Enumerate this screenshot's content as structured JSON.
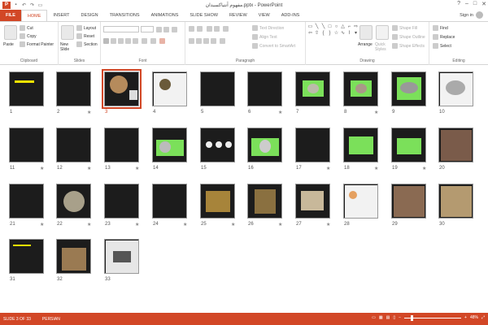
{
  "window": {
    "title": "مفهوم آنتیاکسیدان.pptx - PowerPoint",
    "app_letter": "P",
    "controls": [
      "?",
      "–",
      "□",
      "✕"
    ]
  },
  "tabs": [
    {
      "label": "FILE"
    },
    {
      "label": "HOME",
      "active": true
    },
    {
      "label": "INSERT"
    },
    {
      "label": "DESIGN"
    },
    {
      "label": "TRANSITIONS"
    },
    {
      "label": "ANIMATIONS"
    },
    {
      "label": "SLIDE SHOW"
    },
    {
      "label": "REVIEW"
    },
    {
      "label": "VIEW"
    },
    {
      "label": "ADD-INS"
    }
  ],
  "signin": "Sign in",
  "ribbon": {
    "clipboard": {
      "label": "Clipboard",
      "paste": "Paste",
      "cut": "Cut",
      "copy": "Copy",
      "format_painter": "Format Painter"
    },
    "slides": {
      "label": "Slides",
      "new_slide": "New Slide",
      "layout": "Layout",
      "reset": "Reset",
      "section": "Section"
    },
    "font": {
      "label": "Font"
    },
    "paragraph": {
      "label": "Paragraph",
      "text_direction": "Text Direction",
      "align_text": "Align Text",
      "convert_smartart": "Convert to SmartArt"
    },
    "drawing": {
      "label": "Drawing",
      "arrange": "Arrange",
      "quick_styles": "Quick Styles",
      "shape_fill": "Shape Fill",
      "shape_outline": "Shape Outline",
      "shape_effects": "Shape Effects"
    },
    "editing": {
      "label": "Editing",
      "find": "Find",
      "replace": "Replace",
      "select": "Select"
    }
  },
  "slides": [
    {
      "n": "1",
      "star": false
    },
    {
      "n": "2",
      "star": true
    },
    {
      "n": "3",
      "star": false,
      "selected": true
    },
    {
      "n": "4",
      "star": false
    },
    {
      "n": "5",
      "star": false
    },
    {
      "n": "6",
      "star": true
    },
    {
      "n": "7",
      "star": false
    },
    {
      "n": "8",
      "star": true
    },
    {
      "n": "9",
      "star": false
    },
    {
      "n": "10",
      "star": false
    },
    {
      "n": "11",
      "star": true
    },
    {
      "n": "12",
      "star": true
    },
    {
      "n": "13",
      "star": true
    },
    {
      "n": "14",
      "star": false
    },
    {
      "n": "15",
      "star": false
    },
    {
      "n": "16",
      "star": false
    },
    {
      "n": "17",
      "star": true
    },
    {
      "n": "18",
      "star": true
    },
    {
      "n": "19",
      "star": true
    },
    {
      "n": "20",
      "star": false
    },
    {
      "n": "21",
      "star": true
    },
    {
      "n": "22",
      "star": true
    },
    {
      "n": "23",
      "star": true
    },
    {
      "n": "24",
      "star": true
    },
    {
      "n": "25",
      "star": true
    },
    {
      "n": "26",
      "star": true
    },
    {
      "n": "27",
      "star": true
    },
    {
      "n": "28",
      "star": false
    },
    {
      "n": "29",
      "star": false
    },
    {
      "n": "30",
      "star": false
    },
    {
      "n": "31",
      "star": false
    },
    {
      "n": "32",
      "star": false
    },
    {
      "n": "33",
      "star": false
    }
  ],
  "status": {
    "slide": "SLIDE 3 OF 33",
    "language": "PERSIAN",
    "zoom": "48%"
  },
  "colors": {
    "accent": "#d24726",
    "slide_bg": "#1c1c1c",
    "green_box": "#7be05a",
    "yellow_text": "#f5e400"
  }
}
